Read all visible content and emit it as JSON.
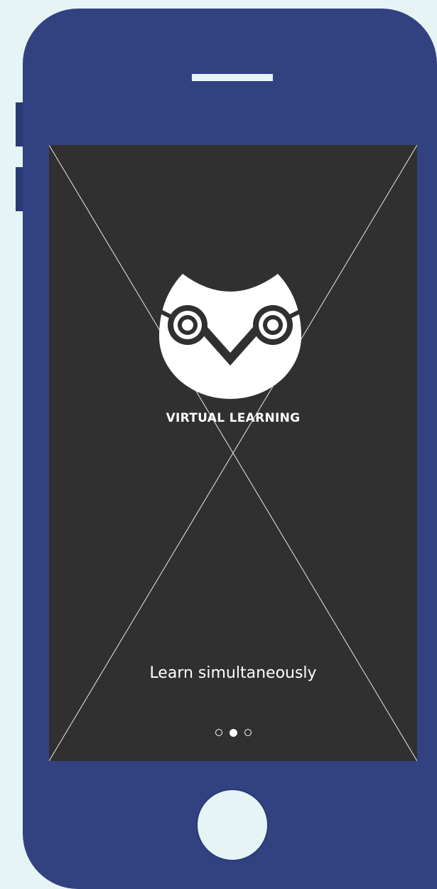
{
  "colors": {
    "background": "#e6f4f6",
    "phone_body": "#324280",
    "screen": "#303030",
    "text": "#ffffff"
  },
  "onboarding": {
    "brand": "VIRTUAL LEARNING",
    "tagline": "Learn simultaneously",
    "logo_icon": "owl-icon",
    "pager": {
      "total_pages": 3,
      "active_page": 2
    }
  },
  "device": {
    "home_button_icon": "home-button",
    "speaker_icon": "speaker-slot"
  }
}
